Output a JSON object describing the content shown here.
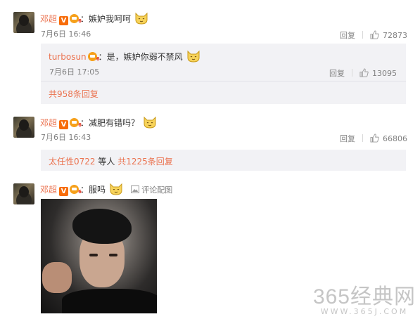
{
  "comments": [
    {
      "username": "邓超",
      "verified_badge": "V",
      "vip_level": "6",
      "text": "：嫉妒我呵呵",
      "time": "7月6日 16:46",
      "reply_label": "回复",
      "likes": "72873",
      "sub_reply": {
        "username": "turbosun",
        "vip_level": "6",
        "text": "：是，嫉妒你弱不禁风",
        "time": "7月6日 17:05",
        "reply_label": "回复",
        "likes": "13095"
      },
      "total_replies": "共958条回复"
    },
    {
      "username": "邓超",
      "verified_badge": "V",
      "vip_level": "6",
      "text": "：减肥有错吗？",
      "time": "7月6日 16:43",
      "reply_label": "回复",
      "likes": "66806",
      "reply_summary": {
        "user": "太任性0722",
        "middle": " 等人 ",
        "count": "共1225条回复"
      }
    },
    {
      "username": "邓超",
      "verified_badge": "V",
      "vip_level": "6",
      "text": "：服吗",
      "image_link_label": "评论配图"
    }
  ],
  "watermark": {
    "line1": "365经典网",
    "line2": "WWW.365J.COM"
  },
  "colors": {
    "username": "#eb7350",
    "meta": "#808080",
    "subreply_bg": "#f2f2f5"
  },
  "icons": [
    "cat-emoji-icon",
    "thumb-up-icon",
    "image-icon",
    "verified-v-icon",
    "vip-level-icon"
  ]
}
